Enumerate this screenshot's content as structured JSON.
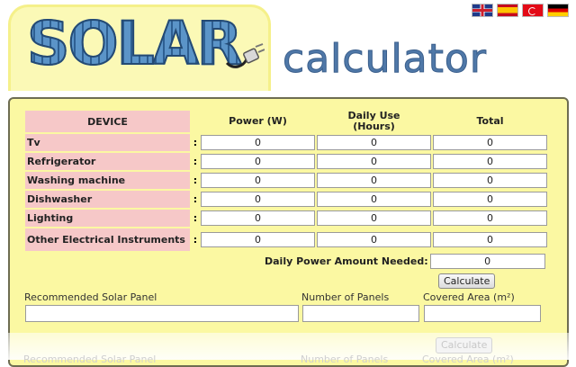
{
  "header": {
    "logo_text": "SOLAR",
    "subtitle": "calculator"
  },
  "flags": [
    {
      "name": "uk-flag-icon"
    },
    {
      "name": "spain-flag-icon"
    },
    {
      "name": "turkey-flag-icon"
    },
    {
      "name": "germany-flag-icon"
    }
  ],
  "table": {
    "headers": {
      "device": "DEVICE",
      "power": "Power (W)",
      "daily_use_line1": "Daily Use",
      "daily_use_line2": "(Hours)",
      "total": "Total"
    },
    "rows": [
      {
        "device": "Tv",
        "power": "0",
        "hours": "0",
        "total": "0"
      },
      {
        "device": "Refrigerator",
        "power": "0",
        "hours": "0",
        "total": "0"
      },
      {
        "device": "Washing machine",
        "power": "0",
        "hours": "0",
        "total": "0"
      },
      {
        "device": "Dishwasher",
        "power": "0",
        "hours": "0",
        "total": "0"
      },
      {
        "device": "Lighting",
        "power": "0",
        "hours": "0",
        "total": "0"
      },
      {
        "device": "Other Electrical Instruments",
        "power": "0",
        "hours": "0",
        "total": "0"
      }
    ],
    "separator": ":"
  },
  "daily_power": {
    "label": "Daily Power Amount Needed:",
    "value": "0"
  },
  "calculate_label": "Calculate",
  "results": {
    "recommended_label": "Recommended Solar Panel",
    "recommended_value": "",
    "panels_label": "Number of Panels",
    "panels_value": "",
    "area_label": "Covered Area (m²)",
    "area_value": ""
  },
  "reflection": {
    "recommended_label": "Recommended Solar Panel",
    "panels_label": "Number of Panels",
    "area_label": "Covered Area (m²)",
    "calculate_label": "Calculate"
  },
  "colors": {
    "panel_bg": "#fbf8a2",
    "device_cell_bg": "#f6c8c8",
    "logo_blue": "#4f84b4"
  }
}
